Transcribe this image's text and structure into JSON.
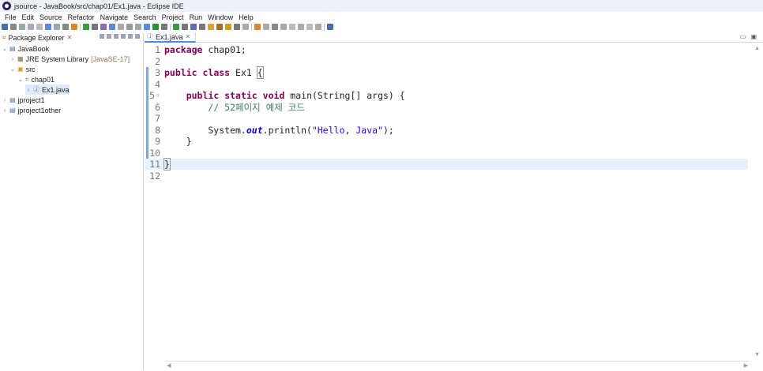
{
  "window": {
    "title": "jsource - JavaBook/src/chap01/Ex1.java - Eclipse IDE"
  },
  "menu": [
    "File",
    "Edit",
    "Source",
    "Refactor",
    "Navigate",
    "Search",
    "Project",
    "Run",
    "Window",
    "Help"
  ],
  "package_explorer": {
    "title": "Package Explorer",
    "tree": [
      {
        "label": "JavaBook",
        "icon": "project-icon"
      },
      {
        "label": "JRE System Library",
        "decoration": "[JavaSE-17]",
        "icon": "library-icon"
      },
      {
        "label": "src",
        "icon": "source-folder-icon"
      },
      {
        "label": "chap01",
        "icon": "package-icon"
      },
      {
        "label": "Ex1.java",
        "icon": "java-file-icon"
      },
      {
        "label": "jproject1",
        "icon": "project-icon"
      },
      {
        "label": "jproject1other",
        "icon": "project-icon"
      }
    ]
  },
  "editor": {
    "tab": "Ex1.java",
    "lines": [
      {
        "n": "1",
        "t": [
          [
            "kw",
            "package"
          ],
          [
            "",
            " chap01;"
          ]
        ]
      },
      {
        "n": "2",
        "t": []
      },
      {
        "n": "3",
        "t": [
          [
            "kw",
            "public"
          ],
          [
            "",
            " "
          ],
          [
            "kw",
            "class"
          ],
          [
            "",
            " Ex1 "
          ],
          [
            "brace",
            "{"
          ]
        ]
      },
      {
        "n": "4",
        "t": []
      },
      {
        "n": "5◦",
        "t": [
          [
            "",
            "    "
          ],
          [
            "kw",
            "public"
          ],
          [
            "",
            " "
          ],
          [
            "kw",
            "static"
          ],
          [
            "",
            " "
          ],
          [
            "kw",
            "void"
          ],
          [
            "",
            " main(String[] "
          ],
          [
            "",
            "args) {"
          ]
        ]
      },
      {
        "n": "6",
        "t": [
          [
            "",
            "        "
          ],
          [
            "com",
            "// 52페이지 예제 코드"
          ]
        ]
      },
      {
        "n": "7",
        "t": []
      },
      {
        "n": "8",
        "t": [
          [
            "",
            "        System."
          ],
          [
            "fld",
            "out"
          ],
          [
            "",
            ".println("
          ],
          [
            "str",
            "\"Hello, Java\""
          ],
          [
            "",
            ");"
          ]
        ]
      },
      {
        "n": "9",
        "t": [
          [
            "",
            "    }"
          ]
        ]
      },
      {
        "n": "10",
        "t": []
      },
      {
        "n": "11",
        "t": [
          [
            "brace",
            "}"
          ]
        ]
      },
      {
        "n": "12",
        "t": []
      }
    ],
    "current_line": 11
  }
}
